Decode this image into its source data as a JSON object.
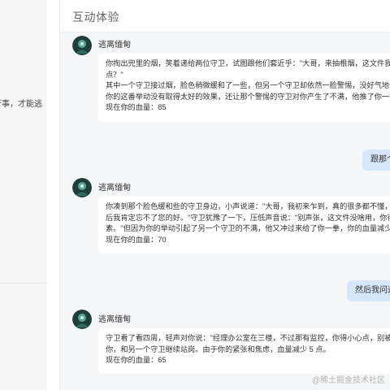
{
  "sidebar": {
    "snippet_lines": [
      "行事，才能逃"
    ]
  },
  "header": {
    "title": "互动体验"
  },
  "bot": {
    "name": "逃离缅甸",
    "avatar_icon": "character-avatar-icon"
  },
  "messages": [
    {
      "role": "bot",
      "lines": [
        "你掏出兜里的烟，笑着递给两位守卫，试图跟他们套近乎：\"大哥，来抽根烟，这文件我实在",
        "点？\"",
        "其中一个守卫接过烟，脸色稍微缓和了一些，但另一个守卫却依然一脸警惕，没好气地说：",
        "你的这番举动没有取得太好的效果，还让那个警惕的守卫对你产生了不满，他推了你一把，",
        "现在你的血量：85"
      ]
    },
    {
      "role": "user",
      "text": "跟那个脸"
    },
    {
      "role": "bot",
      "lines": [
        "你凑到那个脸色缓和些的守卫身边，小声说道：\"大哥，我初来乍到，真的很多都不懂，您就",
        "后我肯定忘不了您的好。\"守卫犹豫了一下，压低声音说：\"别声张，这文件没啥用，你得想",
        "素。\"但因为你的举动引起了另一个守卫的不满，他又冲过来给了你一拳，你的血量减少 1",
        "现在你的血量：70"
      ]
    },
    {
      "role": "user",
      "text": "然后我问这"
    },
    {
      "role": "bot",
      "lines": [
        "守卫看了看四周，轻声对你说：\"经理办公室在三楼，不过那有监控，你得小心点，别被发现",
        "你，和另一个守卫继续站岗。由于你的紧张和焦虑，血量减少 5 点。",
        "现在你的血量：65"
      ]
    }
  ],
  "watermark": "@稀土掘金技术社区"
}
